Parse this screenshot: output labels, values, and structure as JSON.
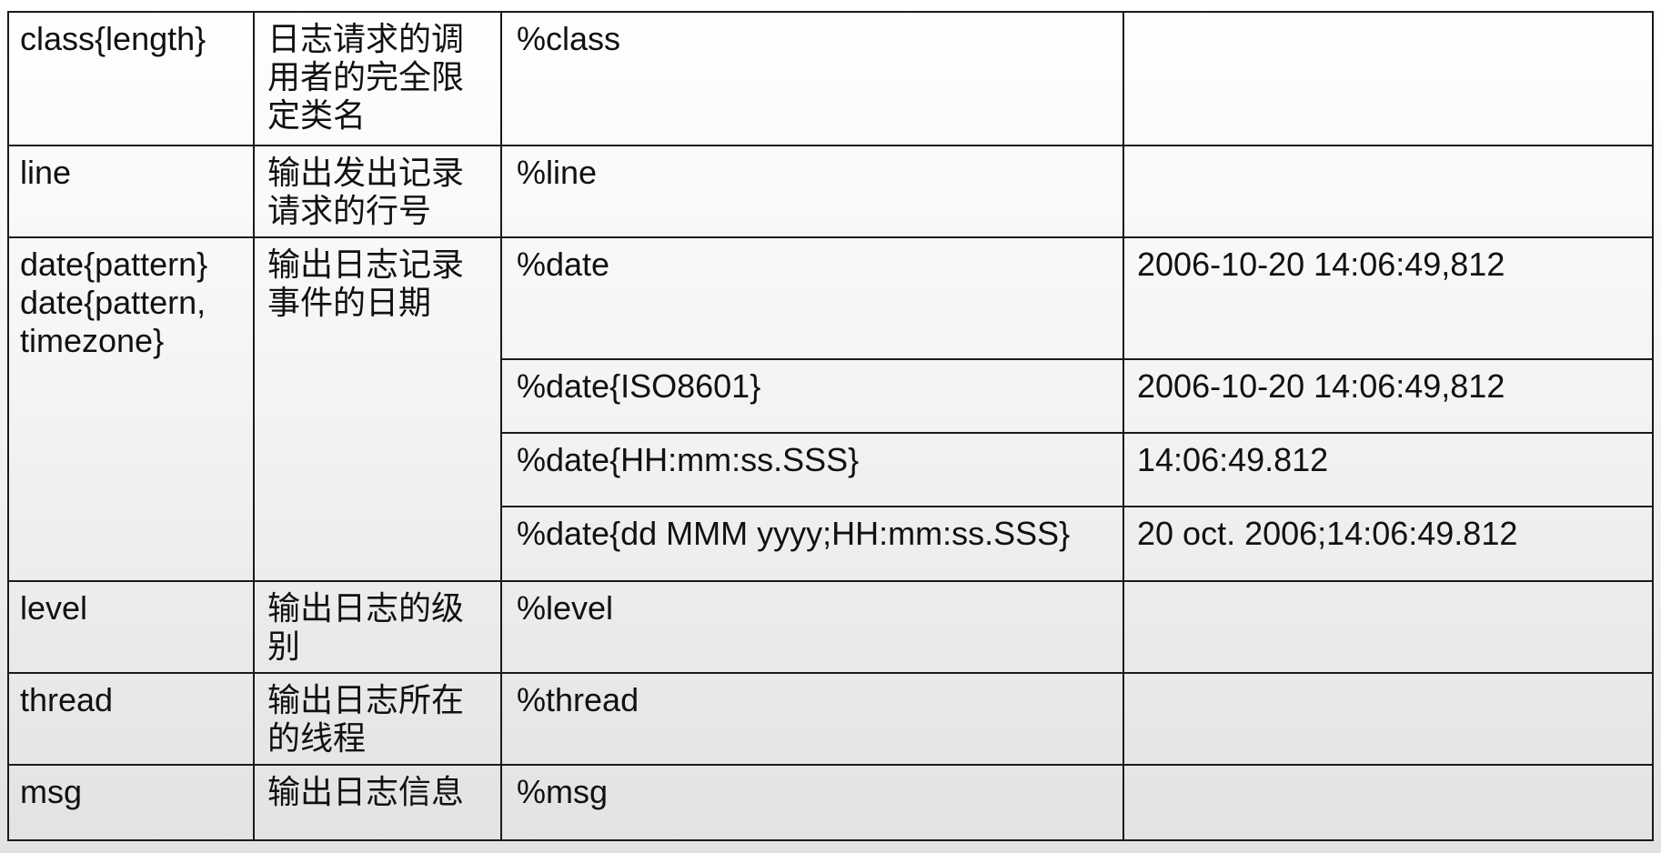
{
  "table": {
    "rows": [
      {
        "name": "class{length}",
        "description": "日志请求的调用者的完全限定类名",
        "formats": [
          {
            "pattern": "%class",
            "example": ""
          }
        ]
      },
      {
        "name": "line",
        "description": "输出发出记录请求的行号",
        "formats": [
          {
            "pattern": "%line",
            "example": ""
          }
        ]
      },
      {
        "name": "date{pattern}\ndate{pattern,\ntimezone}",
        "description": "输出日志记录事件的日期",
        "formats": [
          {
            "pattern": "%date",
            "example": "2006-10-20 14:06:49,812"
          },
          {
            "pattern": "%date{ISO8601}",
            "example": "2006-10-20 14:06:49,812"
          },
          {
            "pattern": "%date{HH:mm:ss.SSS}",
            "example": "14:06:49.812"
          },
          {
            "pattern": "%date{dd MMM yyyy;HH:mm:ss.SSS}",
            "example": "20 oct. 2006;14:06:49.812"
          }
        ]
      },
      {
        "name": "level",
        "description": "输出日志的级别",
        "formats": [
          {
            "pattern": "%level",
            "example": ""
          }
        ]
      },
      {
        "name": "thread",
        "description": "输出日志所在的线程",
        "formats": [
          {
            "pattern": "%thread",
            "example": ""
          }
        ]
      },
      {
        "name": "msg",
        "description": "输出日志信息",
        "formats": [
          {
            "pattern": "%msg",
            "example": ""
          }
        ]
      }
    ]
  }
}
